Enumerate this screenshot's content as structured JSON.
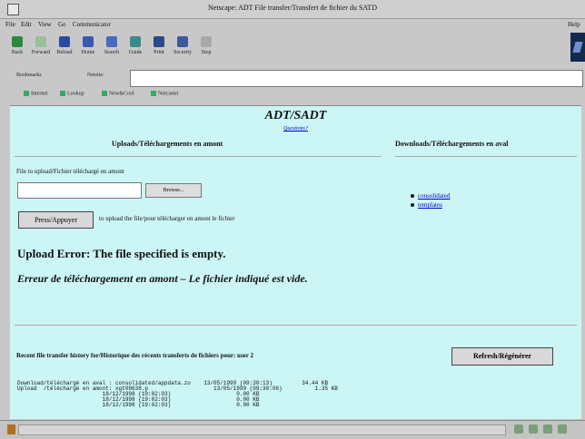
{
  "window": {
    "title": "Netscape: ADT File transfer/Transfert de fichier du SATD"
  },
  "menu": [
    "File",
    "Edit",
    "View",
    "Go",
    "Communicator",
    "Help"
  ],
  "toolbar": [
    "Back",
    "Forward",
    "Reload",
    "Home",
    "Search",
    "Guide",
    "Print",
    "Security",
    "Stop"
  ],
  "location": {
    "bookmarks": "Bookmarks",
    "netsite": "Netsite:"
  },
  "personal": [
    "Internet",
    "Lookup",
    "New&Cool",
    "Netcaster"
  ],
  "page": {
    "heading": "ADT/SADT",
    "help": "Questions?",
    "upload_header": "Uploads/Téléchargements en amont",
    "download_header": "Downloads/Téléchargements en aval",
    "file_label": "File to upload/Fichier téléchargé en amont",
    "browse_label": "Browse...",
    "press_label": "Press/Appuyer",
    "press_text": "to upload the file/pour télécharger en amont le fichier",
    "links": [
      "consolidated",
      "templates"
    ],
    "error_en": "Upload Error: The file specified is empty.",
    "error_fr": "Erreur de téléchargement en amont – Le fichier indiqué est vide.",
    "recent": "Recent file transfer history for/Historique des récents transferts de fichiers pour: user 2",
    "refresh_label": "Refresh/Régénérer",
    "history": "Download/téléchargé en aval : consolidated/appdata.zo    13/05/1999 (09:30:13)         34.44 KB\nUpload  /téléchargé en amont: xgt09638.p                    13/05/1999 (09:30:06)          1.35 KB\n                          18/12/1998 (19:02:03)                    0.00 KB\n                          18/12/1998 (19:02:03)                    0.00 KB\n                          18/12/1998 (19:02:03)                    0.00 KB"
  },
  "colors": {
    "page_bg": "#ccf5f5",
    "chrome": "#c8c8c8",
    "link": "#0000cc"
  }
}
